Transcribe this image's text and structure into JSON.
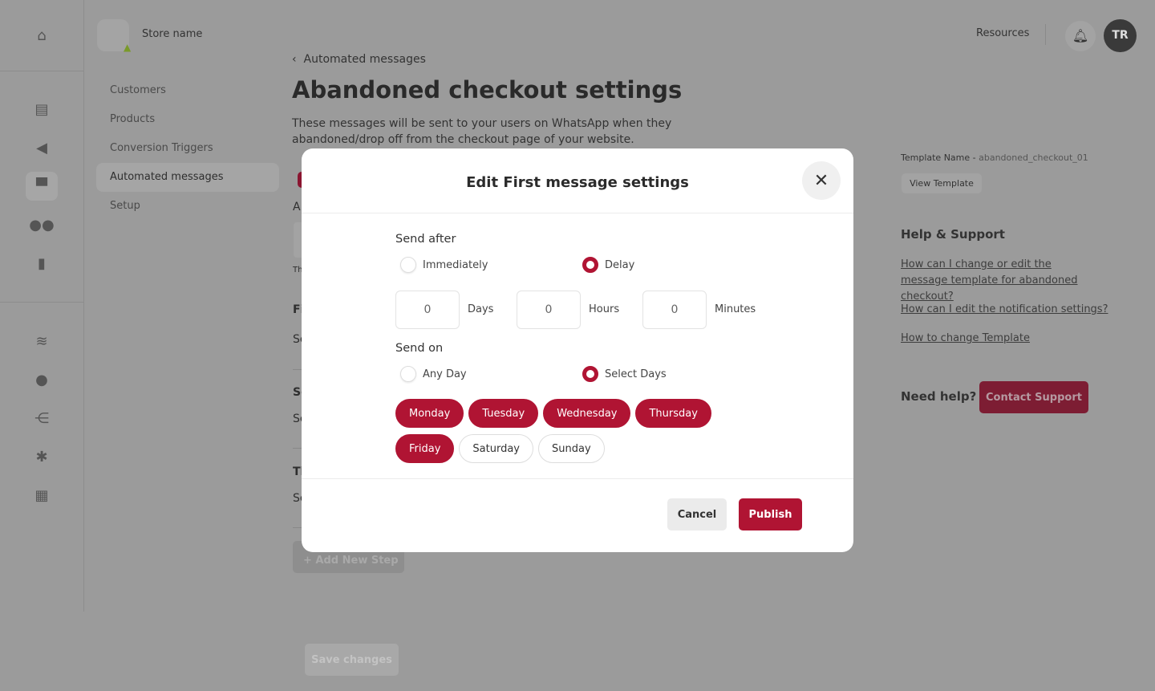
{
  "colors": {
    "accent": "#b01433",
    "overlay": "#9b9b9b"
  },
  "rail": {
    "icons": [
      "home-icon",
      "chat-icon",
      "megaphone-icon",
      "store-icon",
      "users-icon",
      "bar-chart-icon",
      "layers-icon",
      "bulb-icon",
      "flow-icon",
      "gear-icon",
      "puzzle-icon"
    ]
  },
  "store": {
    "name": "Store name"
  },
  "nav": {
    "items": [
      {
        "label": "Customers"
      },
      {
        "label": "Products"
      },
      {
        "label": "Conversion Triggers"
      },
      {
        "label": "Automated messages",
        "active": true
      },
      {
        "label": "Setup"
      }
    ]
  },
  "header": {
    "resources": "Resources",
    "avatar": "TR"
  },
  "page": {
    "breadcrumb": "Automated messages",
    "title": "Abandoned checkout settings",
    "description": "These messages will be sent to your users on WhatsApp when they abandoned/drop off from the checkout page of your website.",
    "fragments": [
      "A",
      "Th",
      "Fi",
      "Se",
      "Se",
      "Se",
      "Th",
      "Se"
    ],
    "add_step": "+ Add New Step",
    "save": "Save changes"
  },
  "right": {
    "template_label": "Template Name - ",
    "template_name": "abandoned_checkout_01",
    "view_template": "View Template",
    "help_title": "Help & Support",
    "links": [
      "How can I change or edit the message template for abandoned checkout?",
      "How can I edit the notification settings?",
      "How to change Template"
    ],
    "need_help": "Need help?",
    "contact": "Contact Support"
  },
  "modal": {
    "title": "Edit First message settings",
    "send_after": "Send after",
    "opt_immediately": "Immediately",
    "opt_delay": "Delay",
    "selected_send_after": "Delay",
    "delay": {
      "days": "0",
      "days_label": "Days",
      "hours": "0",
      "hours_label": "Hours",
      "minutes": "0",
      "minutes_label": "Minutes"
    },
    "send_on": "Send on",
    "opt_any": "Any Day",
    "opt_select": "Select Days",
    "selected_send_on": "Select Days",
    "days": [
      {
        "label": "Monday",
        "selected": true
      },
      {
        "label": "Tuesday",
        "selected": true
      },
      {
        "label": "Wednesday",
        "selected": true
      },
      {
        "label": "Thursday",
        "selected": true
      },
      {
        "label": "Friday",
        "selected": true
      },
      {
        "label": "Saturday",
        "selected": false
      },
      {
        "label": "Sunday",
        "selected": false
      }
    ],
    "cancel": "Cancel",
    "publish": "Publish"
  }
}
